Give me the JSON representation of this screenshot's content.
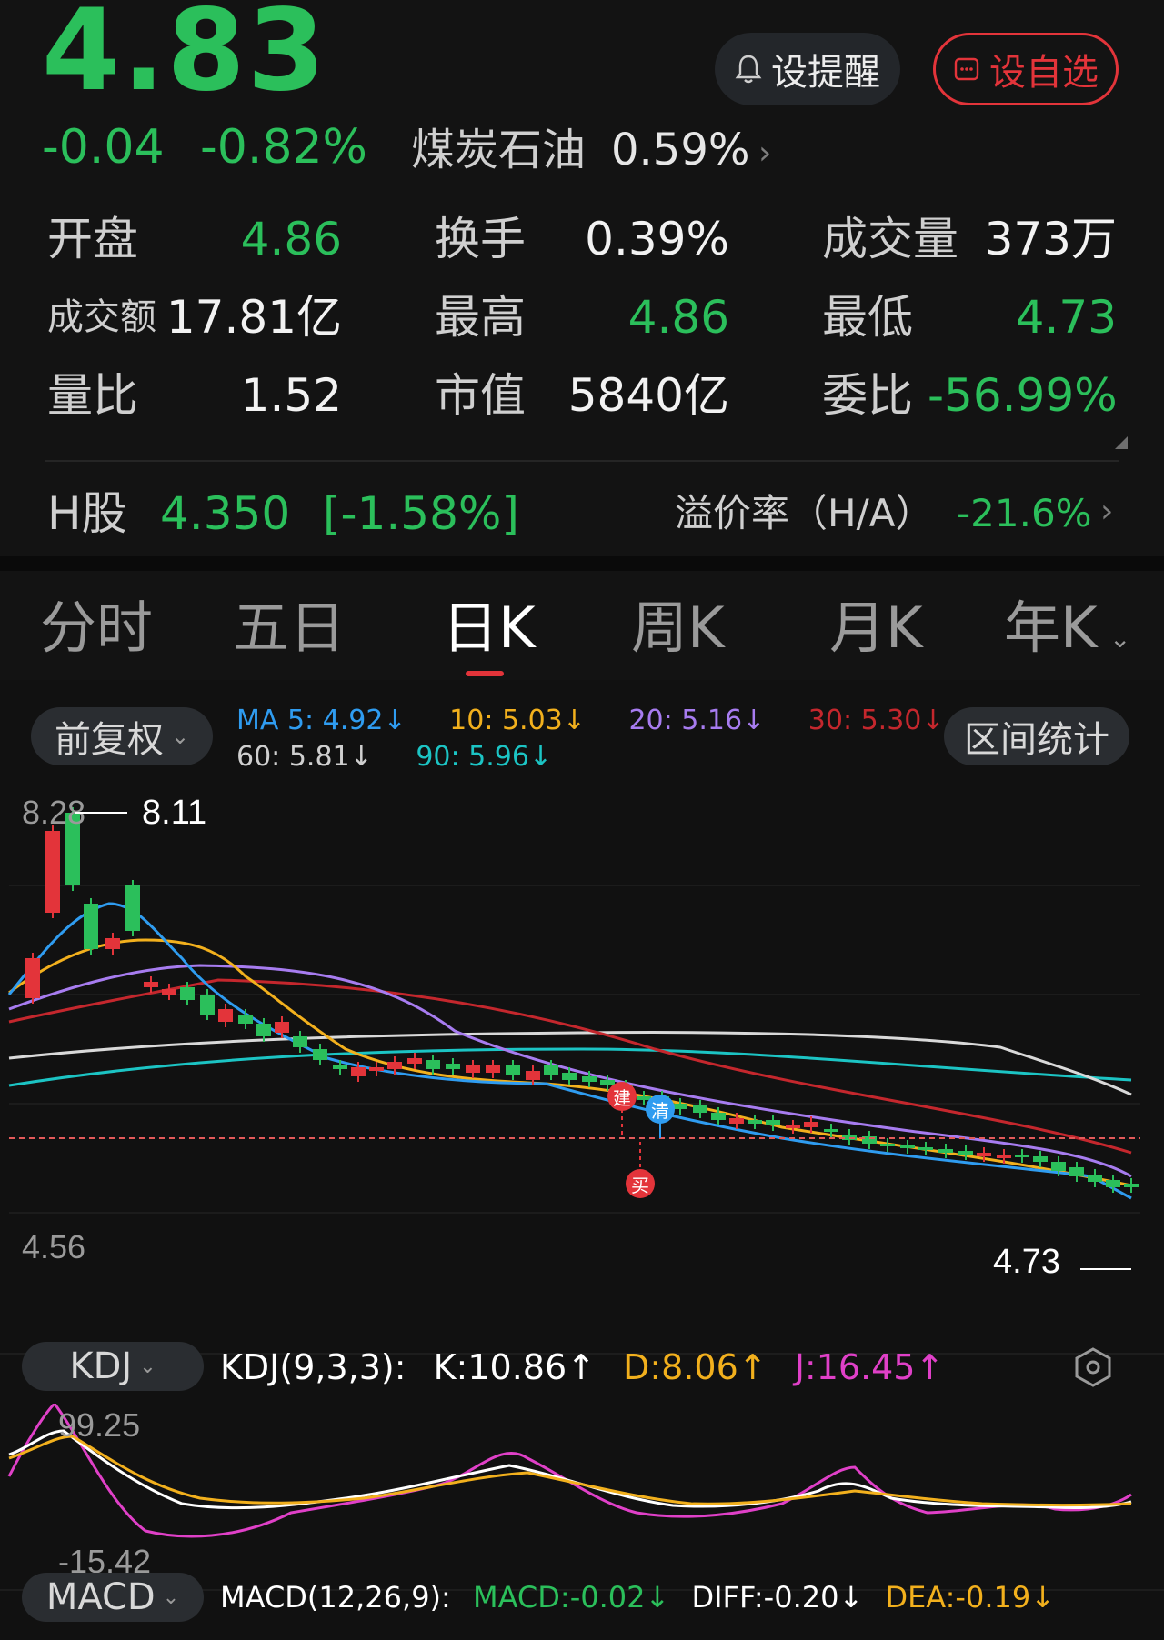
{
  "quote": {
    "price": "4.83",
    "change": "-0.04",
    "change_pct": "-0.82%",
    "sector_name": "煤炭石油",
    "sector_pct": "0.59%",
    "remind_label": "设提醒",
    "favorite_label": "设自选"
  },
  "stats": {
    "open_label": "开盘",
    "open_value": "4.86",
    "turnover_label": "换手",
    "turnover_value": "0.39%",
    "volume_label": "成交量",
    "volume_value": "373万",
    "amount_label": "成交额",
    "amount_value": "17.81亿",
    "high_label": "最高",
    "high_value": "4.86",
    "low_label": "最低",
    "low_value": "4.73",
    "vol_ratio_label": "量比",
    "vol_ratio_value": "1.52",
    "mktcap_label": "市值",
    "mktcap_value": "5840亿",
    "order_ratio_label": "委比",
    "order_ratio_value": "-56.99%"
  },
  "hshare": {
    "label": "H股",
    "value": "4.350",
    "pct": "[-1.58%]",
    "premium_label": "溢价率（H/A）",
    "premium_value": "-21.6%"
  },
  "tabs": [
    {
      "label": "分时"
    },
    {
      "label": "五日"
    },
    {
      "label": "日K"
    },
    {
      "label": "周K"
    },
    {
      "label": "月K"
    },
    {
      "label": "年K"
    }
  ],
  "kline": {
    "adjust_label": "前复权",
    "range_stats_label": "区间统计",
    "ma": {
      "ma5": "MA 5: 4.92↓",
      "ma10": "10: 5.03↓",
      "ma20": "20: 5.16↓",
      "ma30": "30: 5.30↓",
      "ma60": "60: 5.81↓",
      "ma90": "90: 5.96↓"
    },
    "axis_top": "8.28",
    "axis_bottom": "4.56",
    "high_marker": "8.11",
    "low_marker": "4.73",
    "signal_build": "建",
    "signal_clear": "清",
    "signal_buy": "买"
  },
  "kdj": {
    "selector": "KDJ",
    "params": "KDJ(9,3,3):",
    "k": "K:10.86↑",
    "d": "D:8.06↑",
    "j": "J:16.45↑",
    "axis_top": "99.25",
    "axis_bottom": "-15.42"
  },
  "macd": {
    "selector": "MACD",
    "params": "MACD(12,26,9):",
    "macd": "MACD:-0.02↓",
    "diff": "DIFF:-0.20↓",
    "dea": "DEA:-0.19↓"
  },
  "colors": {
    "up": "#e3343a",
    "down": "#2bbf5b",
    "ma5": "#2f9cf0",
    "ma10": "#f2b01d",
    "ma20": "#a77cf0",
    "ma30": "#c4272d",
    "ma60": "#d9d9d9",
    "ma90": "#1cc4c4",
    "kdj_k": "#ffffff",
    "kdj_d": "#f2b01d",
    "kdj_j": "#e040c8"
  }
}
